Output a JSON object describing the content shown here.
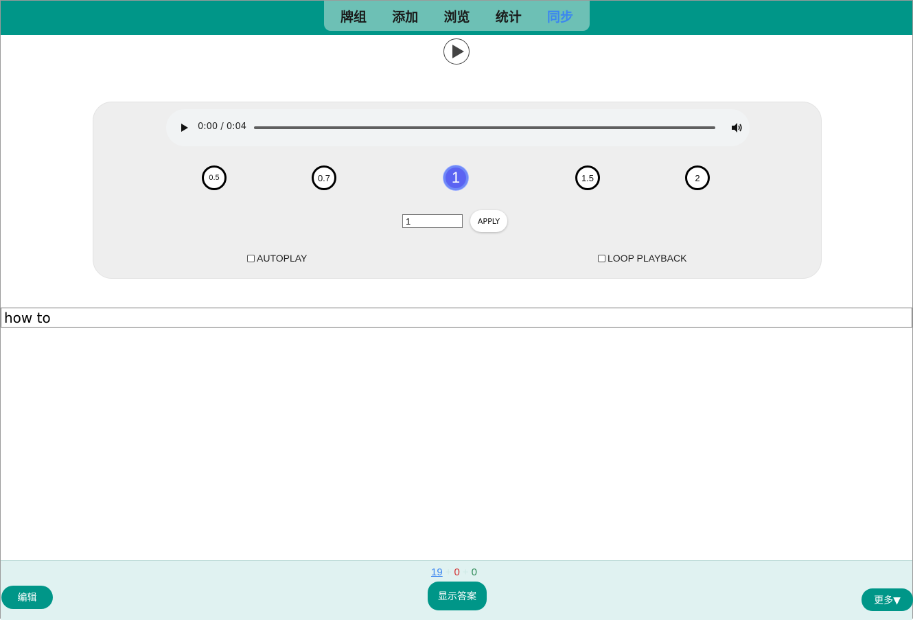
{
  "nav": {
    "items": [
      {
        "label": "牌组",
        "active": false
      },
      {
        "label": "添加",
        "active": false
      },
      {
        "label": "浏览",
        "active": false
      },
      {
        "label": "统计",
        "active": false
      },
      {
        "label": "同步",
        "active": true
      }
    ],
    "active_color": "#3b86f0"
  },
  "player": {
    "play_icon": "play-circle-icon",
    "time": "0:00 / 0:04",
    "speeds": [
      "0.5",
      "0.7",
      "1",
      "1.5",
      "2"
    ],
    "active_speed": "1",
    "rate_input_value": "1",
    "apply_label": "APPLY",
    "autoplay_label": "AUTOPLAY",
    "loop_label": "LOOP PLAYBACK",
    "autoplay_checked": false,
    "loop_checked": false
  },
  "answer_field": {
    "value": "how to"
  },
  "bottom": {
    "counts": {
      "new": "19",
      "plus": "+",
      "learning": "0",
      "review": "0"
    },
    "edit_label": "编辑",
    "show_answer_label": "显示答案",
    "more_label": "更多▼"
  },
  "colors": {
    "brand": "#009688",
    "nav_bg": "#6dc0b5",
    "active_speed": "#5b63f2",
    "bottom_bg": "#e0f2f1"
  }
}
